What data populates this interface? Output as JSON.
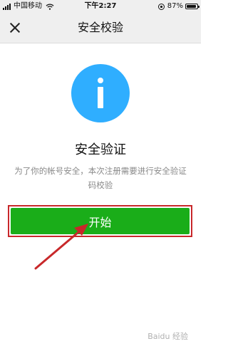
{
  "status_bar": {
    "carrier": "中国移动",
    "time": "下午2:27",
    "battery": "87%"
  },
  "nav": {
    "title": "安全校验",
    "close_icon": "close-icon"
  },
  "main": {
    "icon": "info-icon",
    "heading": "安全验证",
    "description": "为了你的帐号安全，本次注册需要进行安全验证码校验",
    "start_label": "开始"
  },
  "colors": {
    "accent_green": "#1aad19",
    "info_blue": "#2faeff",
    "highlight_red": "#c8282a"
  },
  "watermark": "Baidu 经验"
}
